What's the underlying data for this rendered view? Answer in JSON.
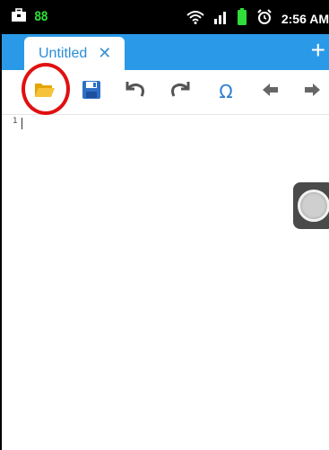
{
  "statusbar": {
    "left_icons": [
      "briefcase-icon",
      "battery-counter-icon"
    ],
    "battery_text": "88",
    "right_icons": [
      "wifi-icon",
      "signal-icon",
      "battery-icon",
      "alarm-icon"
    ],
    "time": "2:56 AM"
  },
  "tabs": [
    {
      "label": "Untitled",
      "close_symbol": "✕"
    }
  ],
  "add_tab_symbol": "+",
  "toolbar": {
    "buttons": [
      {
        "name": "open-folder",
        "icon": "folder-open-icon"
      },
      {
        "name": "save",
        "icon": "floppy-disk-icon"
      },
      {
        "name": "undo",
        "icon": "undo-icon"
      },
      {
        "name": "redo",
        "icon": "redo-icon"
      },
      {
        "name": "special-characters",
        "icon": "omega-icon",
        "glyph": "Ω"
      },
      {
        "name": "previous",
        "icon": "arrow-left-icon"
      },
      {
        "name": "next",
        "icon": "arrow-right-icon"
      }
    ]
  },
  "editor": {
    "line_number": "1",
    "content": ""
  },
  "colors": {
    "tabbar": "#2a9ae8",
    "highlight": "#e01010",
    "toolbar_icon": "#2f7fd0"
  }
}
